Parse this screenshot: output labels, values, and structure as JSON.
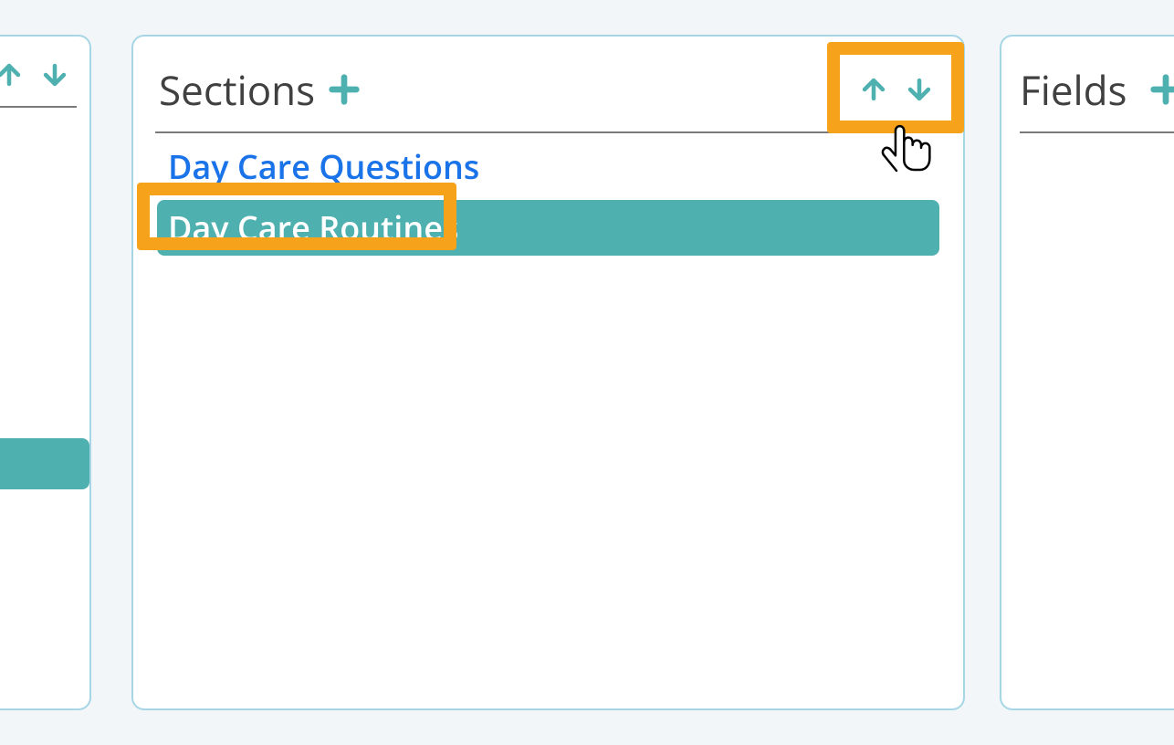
{
  "colors": {
    "accent": "#4fb0b0",
    "highlight": "#f6a21b",
    "link": "#1a73e8"
  },
  "panels": {
    "left": {
      "arrows": {
        "up_icon": "arrow-up",
        "down_icon": "arrow-down"
      }
    },
    "sections": {
      "title": "Sections",
      "add_icon": "plus",
      "move": {
        "up_icon": "arrow-up",
        "down_icon": "arrow-down"
      },
      "items": [
        {
          "label": "Day Care Questions",
          "selected": false
        },
        {
          "label": "Day Care Routines",
          "selected": true
        }
      ]
    },
    "fields": {
      "title": "Fields",
      "add_icon": "plus"
    }
  }
}
